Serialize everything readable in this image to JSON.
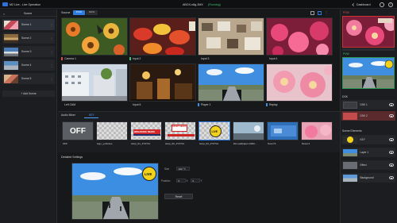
{
  "topbar": {
    "app_title": "M2 Live - Live Operation",
    "device_name": "ABOX-n8g-3MX",
    "device_status": "(Running)",
    "dashboard_label": "Dashboard",
    "help_glyph": "?"
  },
  "scene_panel": {
    "title": "Scene",
    "collapse_glyph": "«",
    "items": [
      {
        "label": "Scene 1",
        "color": "#c44a5a"
      },
      {
        "label": "Scene 2",
        "color": "#8a6a3c"
      },
      {
        "label": "Scene 3",
        "color": "#4a7db5"
      },
      {
        "label": "Scene 4",
        "color": "#5b8fc2"
      },
      {
        "label": "Scene 5",
        "color": "#c8735a"
      }
    ],
    "add_label": "+ Add Scene"
  },
  "source": {
    "title": "Source",
    "tabs": [
      "PVW",
      "MON"
    ],
    "tiles": [
      {
        "name": "Camera 1",
        "tally": "#e14b4b"
      },
      {
        "name": "Input 2",
        "tally": "#3ec26b"
      },
      {
        "name": "Input 3",
        "tally": ""
      },
      {
        "name": "Input 4",
        "tally": ""
      },
      {
        "name": "Left CAM",
        "tally": ""
      },
      {
        "name": "Input 6",
        "tally": ""
      },
      {
        "name": "Player 1",
        "tally": "#3a8ee6"
      },
      {
        "name": "Replay",
        "tally": "#3a8ee6"
      }
    ]
  },
  "mixer": {
    "tabs": [
      "Audio Mixer",
      "KEY"
    ],
    "keys": [
      {
        "name": "OFF",
        "thumb_text": "OFF"
      },
      {
        "name": "logo_yohodoe",
        "thumb_text": ""
      },
      {
        "name": "telop_01_2Y0T2x",
        "thumb_text": "BREAKING NEWS"
      },
      {
        "name": "telop_02_2Y0T2x",
        "thumb_text": "SPORT NEWS"
      },
      {
        "name": "telop_03_2Y0T2x",
        "thumb_text": "LIVE"
      },
      {
        "name": "ibis-wallpaper-1082...",
        "thumb_text": ""
      },
      {
        "name": "Scen74",
        "thumb_text": ""
      },
      {
        "name": "flower4",
        "thumb_text": ""
      }
    ]
  },
  "details": {
    "title": "Detailed Settings",
    "live_text": "LIVE",
    "size_label": "Size",
    "size_value": "100",
    "size_unit": "%",
    "position_label": "Position",
    "pos_x": "0",
    "pos_x_label": "X",
    "pos_y": "0",
    "pos_y_label": "Y",
    "reset_label": "Reset"
  },
  "right_panel": {
    "pgm_label": "PGM",
    "pvw_label": "PVW",
    "dsk_label": "DSK",
    "dsk_layers": [
      {
        "label": "DSK 1",
        "color": "#3a3c41"
      },
      {
        "label": "DSK 2",
        "color": "#c44b4b"
      }
    ],
    "scene_elements_label": "Scene Elements",
    "elements": [
      {
        "label": "KEY",
        "color": "#e8c21a"
      },
      {
        "label": "Layer 1",
        "color": "#4a8ad0"
      },
      {
        "label": "Effect",
        "color": "#6a6d73"
      },
      {
        "label": "Background",
        "color": "#5e9ad8"
      }
    ]
  },
  "colors": {
    "accent": "#2f7de1",
    "program": "#e14b4b",
    "preview": "#3ec26b",
    "running": "#3ec26b"
  }
}
